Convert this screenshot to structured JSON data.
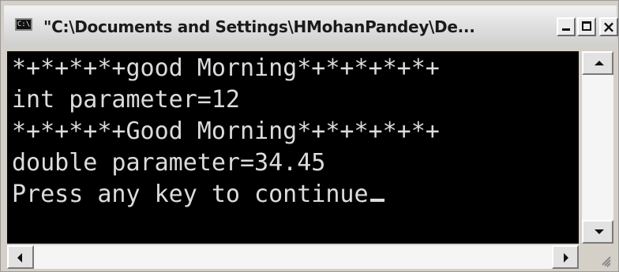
{
  "window": {
    "title": "\"C:\\Documents and Settings\\HMohanPandey\\De...",
    "icon": "console-icon",
    "icon_glyph": "C:\\",
    "buttons": {
      "minimize_icon": "minimize-icon",
      "maximize_icon": "maximize-icon",
      "close_label": "×"
    }
  },
  "console": {
    "lines": [
      "*+*+*+*+good Morning*+*+*+*+*+",
      "int parameter=12",
      "*+*+*+*+Good Morning*+*+*+*+*+",
      "double parameter=34.45",
      "Press any key to continue"
    ],
    "foreground": "#dcdcdc",
    "background": "#000000"
  },
  "colors": {
    "chrome": "#d4d0c8",
    "titlebar": "#dedede",
    "scrollbar_track": "#f5f5f5"
  }
}
